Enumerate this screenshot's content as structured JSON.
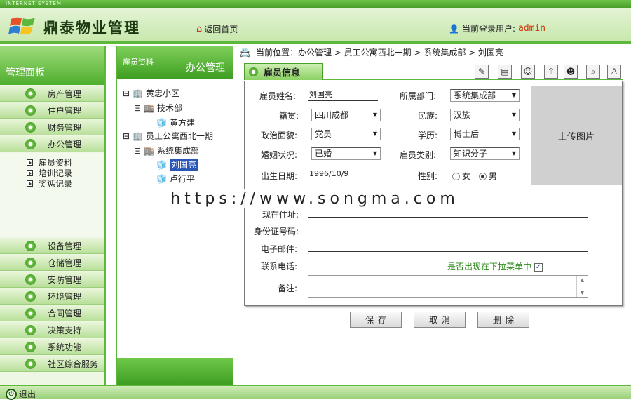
{
  "system_tag": "INTERNET SYSTEM",
  "app_title": "鼎泰物业管理",
  "header": {
    "home": "返回首页",
    "user_label": "当前登录用户:",
    "user": "admin"
  },
  "sidebar": {
    "title": "管理面板",
    "top_items": [
      "房产管理",
      "住户管理",
      "财务管理",
      "办公管理"
    ],
    "sub_items": [
      "雇员资料",
      "培训记录",
      "奖惩记录"
    ],
    "bottom_items": [
      "设备管理",
      "仓储管理",
      "安防管理",
      "环境管理",
      "合同管理",
      "决策支持",
      "系统功能",
      "社区综合服务"
    ]
  },
  "tree": {
    "tab": "雇员资料",
    "title": "办公管理",
    "nodes": [
      "黄忠小区",
      "技术部",
      "黄方建",
      "员工公寓西北一期",
      "系统集成部",
      "刘国亮",
      "卢行平"
    ]
  },
  "breadcrumb": "当前位置：办公管理 > 员工公寓西北一期 > 系统集成部 > 刘国亮",
  "tab_title": "雇员信息",
  "form": {
    "name_label": "雇员姓名:",
    "name": "刘国亮",
    "dept_label": "所属部门:",
    "dept": "系统集成部",
    "native_label": "籍贯:",
    "native": "四川成都",
    "ethnic_label": "民族:",
    "ethnic": "汉族",
    "political_label": "政治面貌:",
    "political": "党员",
    "edu_label": "学历:",
    "edu": "博士后",
    "marital_label": "婚姻状况:",
    "marital": "已婚",
    "type_label": "雇员类别:",
    "type": "知识分子",
    "birth_label": "出生日期:",
    "birth": "1996/10/9",
    "gender_label": "性别:",
    "gender_f": "女",
    "gender_m": "男",
    "address_label": "现在住址:",
    "id_label": "身份证号码:",
    "email_label": "电子邮件:",
    "phone_label": "联系电话:",
    "dropdown_label": "是否出现在下拉菜单中",
    "note_label": "备注:",
    "photo": "上传图片"
  },
  "buttons": {
    "save": "保存",
    "cancel": "取消",
    "delete": "删除"
  },
  "watermark": "https://www.songma.com",
  "footer": {
    "exit": "退出"
  },
  "colors": {
    "accent": "#5cb83a",
    "username": "#d4380d"
  }
}
